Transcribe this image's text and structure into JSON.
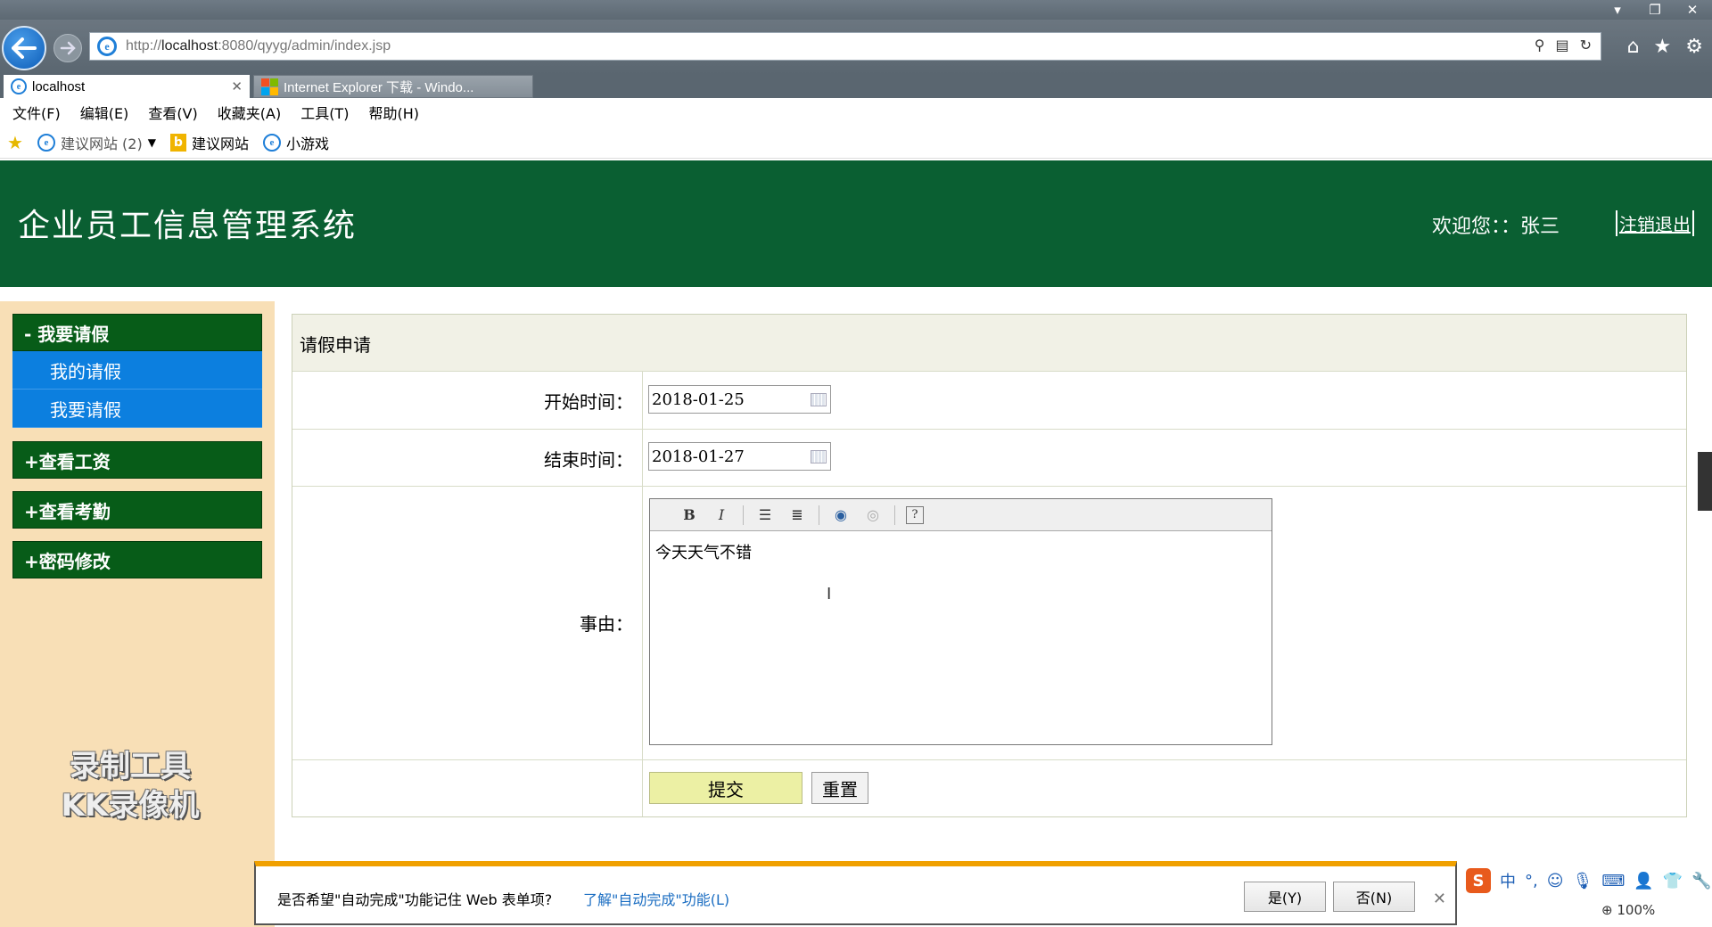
{
  "browser": {
    "url_prefix": "http://",
    "url_host": "localhost",
    "url_rest": ":8080/qyyg/admin/index.jsp",
    "tabs": [
      {
        "label": "localhost"
      },
      {
        "label": "Internet Explorer 下载 - Windo..."
      }
    ],
    "menu": [
      "文件(F)",
      "编辑(E)",
      "查看(V)",
      "收藏夹(A)",
      "工具(T)",
      "帮助(H)"
    ],
    "favorites": [
      {
        "label": "建议网站 (2)",
        "icon": "ie-icon"
      },
      {
        "label": "建议网站",
        "icon": "bing-icon"
      },
      {
        "label": "小游戏",
        "icon": "ie-icon"
      }
    ],
    "zoom": "100%"
  },
  "header": {
    "title": "企业员工信息管理系统",
    "welcome": "欢迎您：：张三",
    "logout": "注销退出"
  },
  "sidebar": {
    "groups": [
      {
        "label": "- 我要请假",
        "items": [
          "我的请假",
          "我要请假"
        ]
      },
      {
        "label": "+查看工资"
      },
      {
        "label": "+查看考勤"
      },
      {
        "label": "+密码修改"
      }
    ],
    "watermark": [
      "录制工具",
      "KK录像机"
    ]
  },
  "form": {
    "title": "请假申请",
    "start_label": "开始时间：",
    "start_value": "2018-01-25",
    "end_label": "结束时间：",
    "end_value": "2018-01-27",
    "reason_label": "事由：",
    "reason_value": "今天天气不错",
    "submit": "提交",
    "reset": "重置"
  },
  "notification": {
    "text": "是否希望\"自动完成\"功能记住 Web 表单项?",
    "link": "了解\"自动完成\"功能(L)",
    "yes": "是(Y)",
    "no": "否(N)"
  },
  "ime": {
    "logo": "S",
    "mode": "中"
  },
  "colors": {
    "header_green": "#0a5f32",
    "sidebar_bg": "#f8dfb6",
    "menu_group": "#075c18",
    "submenu_blue": "#0c7fdf",
    "notify_accent": "#f0a000"
  }
}
